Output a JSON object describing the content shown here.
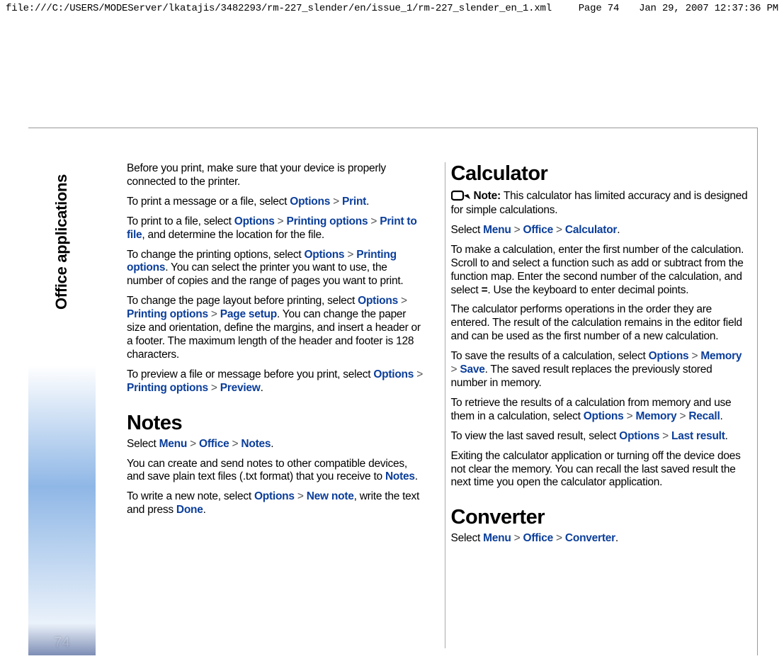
{
  "header": {
    "path": "file:///C:/USERS/MODEServer/lkatajis/3482293/rm-227_slender/en/issue_1/rm-227_slender_en_1.xml",
    "page": "Page 74",
    "date": "Jan 29, 2007 12:37:36 PM"
  },
  "rail": {
    "label": "Office applications",
    "page_number": "74"
  },
  "t": {
    "chev": ">",
    "opts": "Options",
    "menu": "Menu",
    "office": "Office",
    "notes": "Notes",
    "calc": "Calculator",
    "conv": "Converter",
    "print": "Print",
    "print_opts": "Printing options",
    "print_to_file": "Print to file",
    "page_setup": "Page setup",
    "preview": "Preview",
    "new_note": "New note",
    "done": "Done",
    "memory": "Memory",
    "save": "Save",
    "recall": "Recall",
    "last_result": "Last result",
    "eq": "="
  },
  "left": {
    "p1a": "Before you print, make sure that your device is properly connected to the printer.",
    "p2a": "To print a message or a file, select ",
    "p2b": ".",
    "p3a": "To print to a file, select ",
    "p3b": ", and determine the location for the file.",
    "p4a": "To change the printing options, select ",
    "p4b": ". You can select the printer you want to use, the number of copies and the range of pages you want to print.",
    "p5a": "To change the page layout before printing, select ",
    "p5b": ". You can change the paper size and orientation, define the margins, and insert a header or a footer. The maximum length of the header and footer is 128 characters.",
    "p6a": "To preview a file or message before you print, select ",
    "p6b": ".",
    "h_notes": "Notes",
    "n1a": "Select ",
    "n1b": ".",
    "n2a": "You can create and send notes to other compatible devices, and save plain text files (.txt format) that you receive to ",
    "n2b": ".",
    "n3a": "To write a new note, select ",
    "n3b": ", write the text and press ",
    "n3c": "."
  },
  "right": {
    "h_calc": "Calculator",
    "note_label": "Note:  ",
    "note_body": "This calculator has limited accuracy and is designed for simple calculations.",
    "c1a": "Select ",
    "c1b": ".",
    "c2a": "To make a calculation, enter the first number of the calculation. Scroll to and select a function such as add or subtract from the function map. Enter the second number of the calculation, and select ",
    "c2b": ". Use the keyboard to enter decimal points.",
    "c3": "The calculator performs operations in the order they are entered. The result of the calculation remains in the editor field and can be used as the first number of a new calculation.",
    "c4a": "To save the results of a calculation, select ",
    "c4b": ". The saved result replaces the previously stored number in memory.",
    "c5a": "To retrieve the results of a calculation from memory and use them in a calculation, select ",
    "c5b": ".",
    "c6a": "To view the last saved result, select ",
    "c6b": ".",
    "c7": "Exiting the calculator application or turning off the device does not clear the memory. You can recall the last saved result the next time you open the calculator application.",
    "h_conv": "Converter",
    "v1a": "Select ",
    "v1b": "."
  }
}
